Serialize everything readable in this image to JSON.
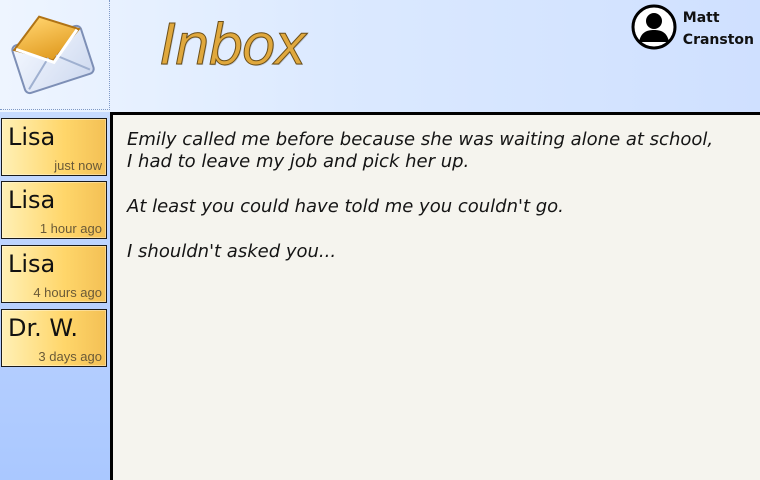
{
  "header": {
    "title": "Inbox",
    "user": {
      "first_name": "Matt",
      "last_name": "Cranston"
    }
  },
  "sidebar": {
    "messages": [
      {
        "sender": "Lisa",
        "time": "just now"
      },
      {
        "sender": "Lisa",
        "time": "1 hour ago"
      },
      {
        "sender": "Lisa",
        "time": "4 hours ago"
      },
      {
        "sender": "Dr. W.",
        "time": "3 days ago"
      }
    ]
  },
  "message": {
    "lines": [
      "Emily called me before because she was waiting alone at school,",
      "I had to leave my job and pick her up.",
      "At least you could have told me you couldn't go.",
      "I shouldn't asked you..."
    ]
  },
  "icons": {
    "logo": "envelope-icon",
    "avatar": "user-silhouette-icon"
  },
  "colors": {
    "title": "#e0a83d",
    "item_start": "#fff0b5",
    "item_end": "#f3c055",
    "panel": "#f5f4ee"
  }
}
